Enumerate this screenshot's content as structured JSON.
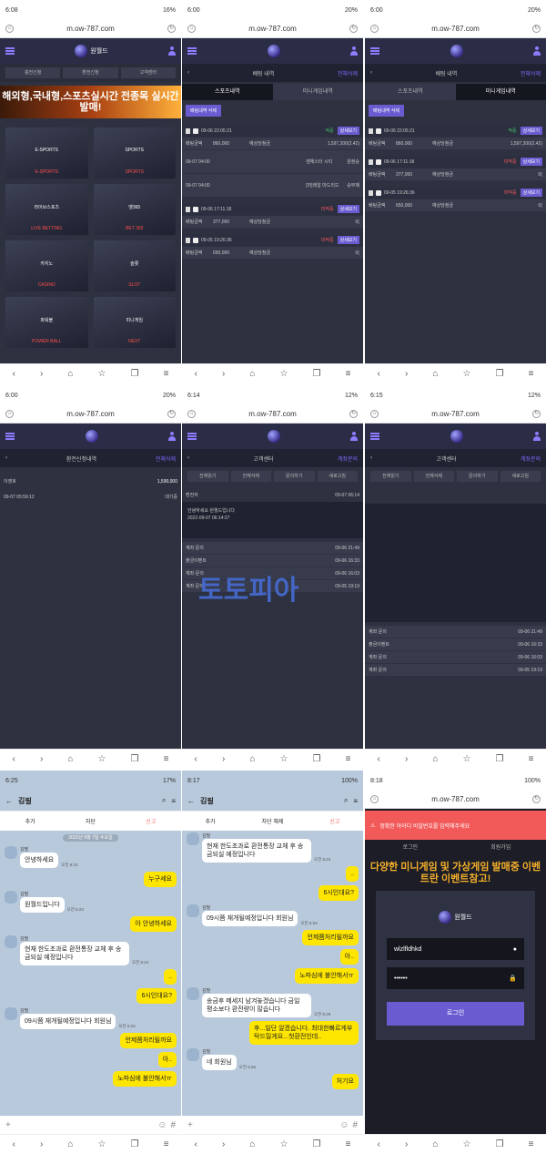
{
  "p1": {
    "time": "6:08",
    "battery": "16%",
    "url": "m.ow-787.com",
    "logo": "원월드",
    "quick": [
      "충전신청",
      "환전신청",
      "고객센터"
    ],
    "banner": "해외형,국내형,스포츠실시간 전종목 실시간발매!",
    "cards": [
      {
        "name": "E-SPORTS",
        "cap": "E-SPORTS"
      },
      {
        "name": "SPORTS",
        "cap": "SPORTS"
      },
      {
        "name": "라이브스포츠",
        "cap": "LIVE BETTING"
      },
      {
        "name": "벳365",
        "cap": "BET 365"
      },
      {
        "name": "카지노",
        "cap": "CASINO"
      },
      {
        "name": "슬롯",
        "cap": "SLOT"
      },
      {
        "name": "파워볼",
        "cap": "POWER BALL"
      },
      {
        "name": "미니게임",
        "cap": "NEXT"
      }
    ]
  },
  "p2": {
    "time": "6:00",
    "battery": "20%",
    "url": "m.ow-787.com",
    "title": "배팅 내역",
    "right": "전체삭제",
    "tabs": [
      "스포츠내역",
      "미니게임내역"
    ],
    "btn": "배팅내역 삭제",
    "b1": {
      "date": "09-06 22:05:21",
      "status": "적중",
      "btn": "상세보기",
      "bet": "배팅금액",
      "betv": "860,000",
      "est": "예상당첨금",
      "estv": "1,597,200(2.42)"
    },
    "d1": {
      "t": "09-07 04:00",
      "team": "맨체스터 시티",
      "pick": "원정승"
    },
    "d2": {
      "t": "09-07 04:00",
      "team": "[마]레알 마드리드",
      "pick": "승무패"
    },
    "b2": {
      "date": "09-06 17:11:18",
      "status": "미적중",
      "btn": "상세보기",
      "bet": "배팅금액",
      "betv": "377,000",
      "est": "예상당첨금",
      "estv": "0("
    },
    "b3": {
      "date": "09-05 19:26:36",
      "status": "미적중",
      "btn": "상세보기",
      "bet": "배팅금액",
      "betv": "650,000",
      "est": "예상당첨금",
      "estv": "0("
    }
  },
  "p3": {
    "time": "6:00",
    "battery": "20%",
    "url": "m.ow-787.com"
  },
  "p4": {
    "time": "6:00",
    "battery": "20%",
    "url": "m.ow-787.com",
    "title": "환전신청내역",
    "right": "전체삭제",
    "amount": "1,590,000",
    "who": "이영호",
    "date": "09-07 05:59:12",
    "status": "대기중"
  },
  "p5": {
    "time": "6:14",
    "battery": "12%",
    "url": "m.ow-787.com",
    "title": "고객센터",
    "right": "계좌문의",
    "tabs": [
      "전체읽기",
      "전체삭제",
      "문의하기",
      "새로고침"
    ],
    "head": "환전자",
    "hdate": "09-07 06:14",
    "msg": "안녕하세요 원월드입니다",
    "sub": "2022-09-07 06:14:27",
    "items": [
      {
        "t": "계좌 문의",
        "d": "09-06 21:49"
      },
      {
        "t": "출금이벤트",
        "d": "09-06 16:33"
      },
      {
        "t": "계좌 문의",
        "d": "09-06 16:03"
      },
      {
        "t": "계좌 문의",
        "d": "09-05 19:19"
      }
    ],
    "wm": "토토피아"
  },
  "p6": {
    "time": "6:15",
    "battery": "12%",
    "url": "m.ow-787.com",
    "title": "고객센터",
    "right": "계좌문의",
    "tabs": [
      "전체읽기",
      "전체삭제",
      "문의하기",
      "새로고침"
    ],
    "items": [
      {
        "t": "계좌 문의",
        "d": "09-06 21:49"
      },
      {
        "t": "출금이벤트",
        "d": "09-06 16:33"
      },
      {
        "t": "계좌 문의",
        "d": "09-06 16:03"
      },
      {
        "t": "계좌 문의",
        "d": "09-05 19:19"
      }
    ]
  },
  "p7": {
    "time": "6:25",
    "battery": "17%",
    "name": "김필",
    "acts": [
      "추가",
      "차단",
      "신고"
    ],
    "date": "2022년 9월 7일 수요일",
    "msgs": [
      {
        "s": "L",
        "t": "안녕하세요",
        "tm": "오전 6:23"
      },
      {
        "s": "R",
        "t": "누구세요"
      },
      {
        "s": "L",
        "t": "원월드입니다",
        "tm": "오전 6:23"
      },
      {
        "s": "R",
        "t": "아 안녕하세요"
      },
      {
        "s": "L",
        "t": "현재 한도초과로 환전통장 교체 후 송금되실 예정입니다",
        "tm": "오전 6:24"
      },
      {
        "s": "R",
        "t": ".."
      },
      {
        "s": "R",
        "t": "6시인대요?"
      },
      {
        "s": "L",
        "t": "09시쯤 재개될예정입니다 회원님",
        "tm": "오전 6:24"
      },
      {
        "s": "R",
        "t": "언제쯤처리될까요"
      },
      {
        "s": "R",
        "t": "아.."
      },
      {
        "s": "R",
        "t": "노파심에 불안해서ㅠ"
      }
    ]
  },
  "p8": {
    "time": "8:17",
    "battery": "100%",
    "name": "김필",
    "acts": [
      "추가",
      "차단 해제",
      "신고"
    ],
    "msgs": [
      {
        "s": "L",
        "t": "현재 한도초과로 환전통장 교체 후 송금되실 예정입니다",
        "tm": "오전 6:24"
      },
      {
        "s": "R",
        "t": ".."
      },
      {
        "s": "R",
        "t": "6시인대요?"
      },
      {
        "s": "L",
        "t": "09시쯤 재개될예정입니다 회원님",
        "tm": "오전 6:24"
      },
      {
        "s": "R",
        "t": "언제쯤처리될까요"
      },
      {
        "s": "R",
        "t": "아.."
      },
      {
        "s": "R",
        "t": "노파심에 불안해서ㅠ"
      },
      {
        "s": "L",
        "t": "송금후 메세지 남겨놓겠습니다 금일 평소보다 환전량이 많습니다",
        "tm": "오전 6:26"
      },
      {
        "s": "R",
        "t": "후...일단 알겠습니다. 최대한빠르게부탁드릴게요...첫환전인데.."
      },
      {
        "s": "L",
        "t": "네 회원님",
        "tm": "오전 6:26"
      },
      {
        "s": "R",
        "t": "처기요"
      }
    ]
  },
  "p9": {
    "time": "8:18",
    "battery": "100%",
    "url": "m.ow-787.com",
    "alert": "정확한 아이디 비밀번호를 입력해주세요",
    "tabs": [
      "로그인",
      "회원가입"
    ],
    "banner": "다양한 미니게임 및 가상게임 발매중 이벤트란 이벤트참고!",
    "logo": "원월드",
    "id": "wlzlfldhkd",
    "pw": "••••••",
    "login": "로그인"
  }
}
